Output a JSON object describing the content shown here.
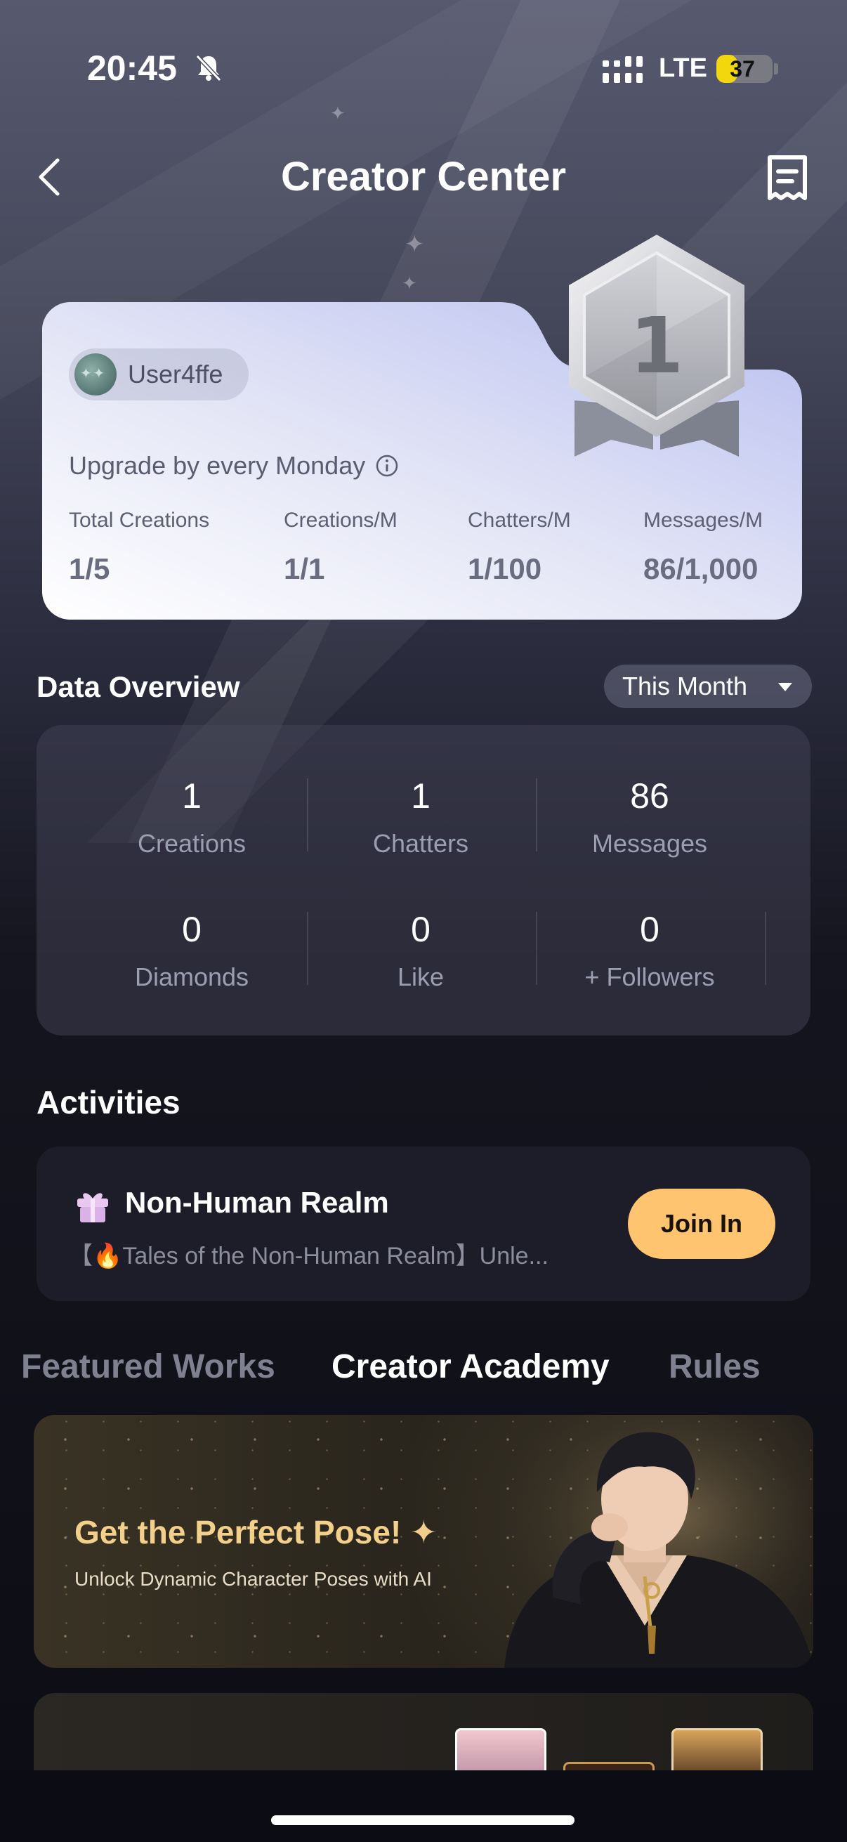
{
  "status_bar": {
    "time": "20:45",
    "network": "LTE",
    "battery": "37",
    "battery_level": 0.37
  },
  "nav": {
    "title": "Creator Center"
  },
  "creator_card": {
    "username": "User4ffe",
    "upgrade_note": "Upgrade by every Monday",
    "level": "1",
    "stats": [
      {
        "label": "Total Creations",
        "value": "1/5"
      },
      {
        "label": "Creations/M",
        "value": "1/1"
      },
      {
        "label": "Chatters/M",
        "value": "1/100"
      },
      {
        "label": "Messages/M",
        "value": "86/1,000"
      }
    ]
  },
  "overview": {
    "title": "Data Overview",
    "period": "This Month",
    "metrics": [
      {
        "value": "1",
        "label": "Creations"
      },
      {
        "value": "1",
        "label": "Chatters"
      },
      {
        "value": "86",
        "label": "Messages"
      },
      {
        "value": "0",
        "label": "Diamonds"
      },
      {
        "value": "0",
        "label": "Like"
      },
      {
        "value": "0",
        "label": "+ Followers"
      }
    ]
  },
  "activities": {
    "title": "Activities",
    "item": {
      "title": "Non-Human Realm",
      "description": "【🔥Tales of the Non-Human Realm】Unle...",
      "button": "Join In"
    }
  },
  "tabs": [
    "Featured Works",
    "Creator Academy",
    "Rules"
  ],
  "active_tab": "Creator Academy",
  "banner": {
    "title": "Get the Perfect Pose! ✦",
    "subtitle": "Unlock Dynamic Character Poses with AI"
  },
  "colors": {
    "accent": "#ffc46f",
    "banner_title": "#f2cf8a"
  }
}
